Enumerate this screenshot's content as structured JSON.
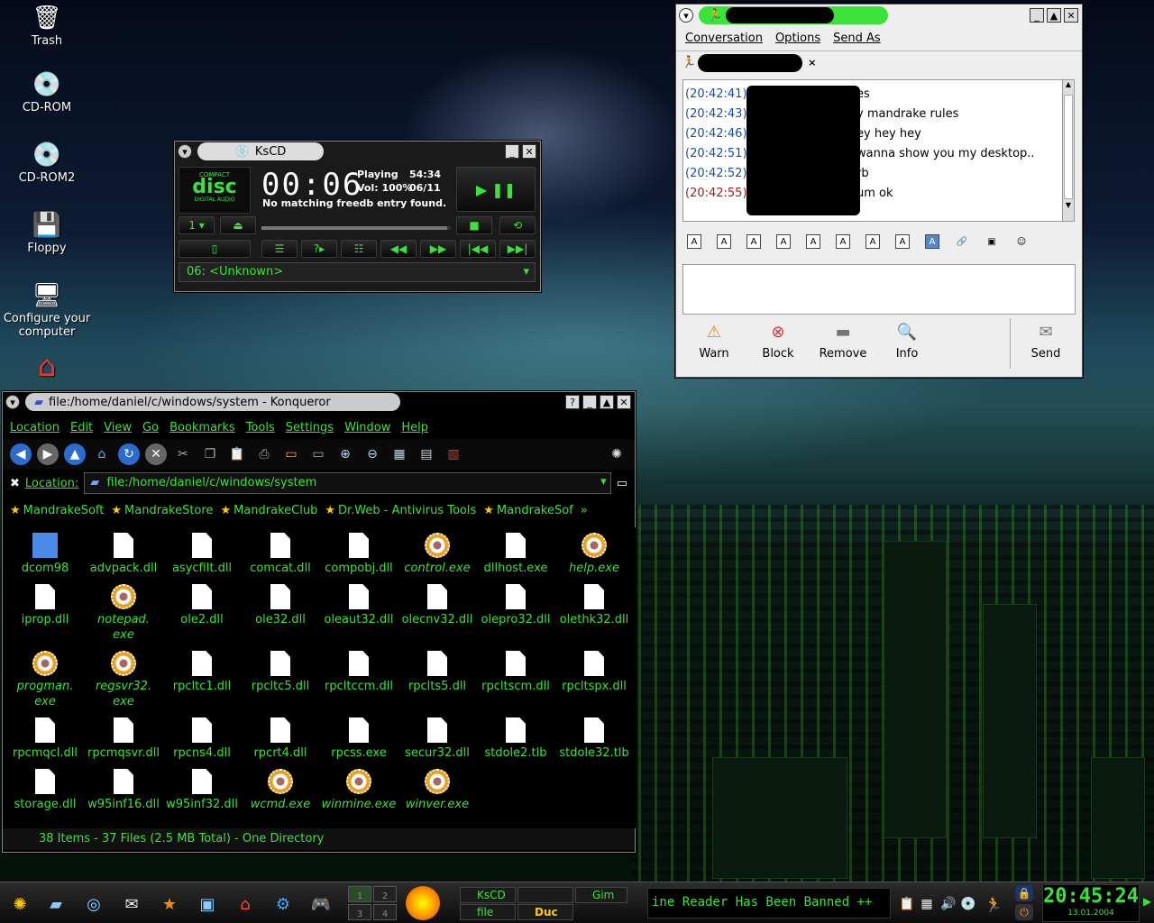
{
  "desktop": {
    "icons": [
      {
        "label": "Trash",
        "icon": "trash-icon"
      },
      {
        "label": "CD-ROM",
        "icon": "cdrom-icon"
      },
      {
        "label": "CD-ROM2",
        "icon": "cdrom-icon"
      },
      {
        "label": "Floppy",
        "icon": "floppy-icon"
      },
      {
        "label": "Configure your computer",
        "icon": "monitor-config-icon"
      },
      {
        "label": "",
        "icon": "home-icon"
      }
    ]
  },
  "kscd": {
    "title": "KsCD",
    "logo_top": "COMPACT",
    "logo_main": "disc",
    "logo_bottom": "DIGITAL AUDIO",
    "time": "00:06",
    "status": "Playing",
    "total_time": "54:34",
    "volume": "Vol: 100%",
    "track_counter": "06/11",
    "freedb_message": "No matching freedb entry found.",
    "track_label": "06: <Unknown>",
    "seek_position": 0.98
  },
  "konqueror": {
    "title": "file:/home/daniel/c/windows/system - Konqueror",
    "menu": [
      "Location",
      "Edit",
      "View",
      "Go",
      "Bookmarks",
      "Tools",
      "Settings",
      "Window",
      "Help"
    ],
    "location_label": "Location:",
    "location_value": "file:/home/daniel/c/windows/system",
    "bookmarks": [
      "MandrakeSoft",
      "MandrakeStore",
      "MandrakeClub",
      "Dr.Web - Antivirus Tools",
      "MandrakeSof"
    ],
    "bookmarks_more": "»",
    "files": [
      {
        "name": "dcom98",
        "kind": "folder"
      },
      {
        "name": "advpack.dll",
        "kind": "doc"
      },
      {
        "name": "asycfilt.dll",
        "kind": "doc"
      },
      {
        "name": "comcat.dll",
        "kind": "doc"
      },
      {
        "name": "compobj.dll",
        "kind": "doc"
      },
      {
        "name": "control.exe",
        "kind": "exe"
      },
      {
        "name": "dllhost.exe",
        "kind": "doc"
      },
      {
        "name": "help.exe",
        "kind": "exe"
      },
      {
        "name": "iprop.dll",
        "kind": "doc"
      },
      {
        "name": "notepad.\nexe",
        "kind": "exe"
      },
      {
        "name": "ole2.dll",
        "kind": "doc"
      },
      {
        "name": "ole32.dll",
        "kind": "doc"
      },
      {
        "name": "oleaut32.dll",
        "kind": "doc"
      },
      {
        "name": "olecnv32.dll",
        "kind": "doc"
      },
      {
        "name": "olepro32.dll",
        "kind": "doc"
      },
      {
        "name": "olethk32.dll",
        "kind": "doc"
      },
      {
        "name": "progman.\nexe",
        "kind": "exe"
      },
      {
        "name": "regsvr32.\nexe",
        "kind": "exe"
      },
      {
        "name": "rpcltc1.dll",
        "kind": "doc"
      },
      {
        "name": "rpcltc5.dll",
        "kind": "doc"
      },
      {
        "name": "rpcltccm.dll",
        "kind": "doc"
      },
      {
        "name": "rpclts5.dll",
        "kind": "doc"
      },
      {
        "name": "rpcltscm.dll",
        "kind": "doc"
      },
      {
        "name": "rpcltspx.dll",
        "kind": "doc"
      },
      {
        "name": "rpcmqcl.dll",
        "kind": "doc"
      },
      {
        "name": "rpcmqsvr.dll",
        "kind": "doc"
      },
      {
        "name": "rpcns4.dll",
        "kind": "doc"
      },
      {
        "name": "rpcrt4.dll",
        "kind": "doc"
      },
      {
        "name": "rpcss.exe",
        "kind": "doc"
      },
      {
        "name": "secur32.dll",
        "kind": "doc"
      },
      {
        "name": "stdole2.tlb",
        "kind": "doc"
      },
      {
        "name": "stdole32.tlb",
        "kind": "doc"
      },
      {
        "name": "storage.dll",
        "kind": "doc"
      },
      {
        "name": "w95inf16.dll",
        "kind": "doc"
      },
      {
        "name": "w95inf32.dll",
        "kind": "doc"
      },
      {
        "name": "wcmd.exe",
        "kind": "exe"
      },
      {
        "name": "winmine.exe",
        "kind": "exe"
      },
      {
        "name": "winver.exe",
        "kind": "exe"
      }
    ],
    "status": "38 Items - 37 Files (2.5 MB Total) - One Directory"
  },
  "gaim": {
    "menu": [
      "Conversation",
      "Options",
      "Send As"
    ],
    "tab_close": "×",
    "messages": [
      {
        "time": "(20:42:41)",
        "text": "es",
        "color": "#1a4fa0"
      },
      {
        "time": "(20:42:43)",
        "text": "y mandrake rules",
        "color": "#1a4fa0"
      },
      {
        "time": "(20:42:46)",
        "text": "ey hey hey",
        "color": "#1a4fa0"
      },
      {
        "time": "(20:42:51)",
        "text": "wanna show you my desktop..",
        "color": "#1a4fa0"
      },
      {
        "time": "(20:42:52)",
        "text": "rb",
        "color": "#1a4fa0"
      },
      {
        "time": "(20:42:55)",
        "text": "um ok",
        "color": "#a02020"
      }
    ],
    "format_buttons": [
      "A",
      "A",
      "A",
      "A",
      "A",
      "A",
      "A",
      "A",
      "A"
    ],
    "actions": [
      {
        "label": "Warn",
        "icon": "warning-icon"
      },
      {
        "label": "Block",
        "icon": "block-icon"
      },
      {
        "label": "Remove",
        "icon": "remove-icon"
      },
      {
        "label": "Info",
        "icon": "info-icon"
      },
      {
        "label": "Send",
        "icon": "send-icon"
      }
    ]
  },
  "taskbar": {
    "pager": [
      "1",
      "2",
      "3",
      "4"
    ],
    "tasks": [
      "KsCD",
      "file",
      "Gim",
      "Duc"
    ],
    "ticker": "ine Reader Has Been Banned ++",
    "clock_time": "20:45:24",
    "clock_date": "13.01.2004",
    "accent": "#3ae33a"
  }
}
